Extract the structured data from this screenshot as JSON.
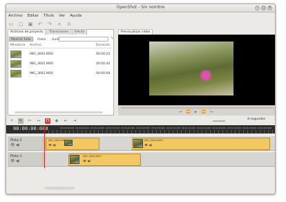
{
  "window": {
    "title": "OpenShot - Sin nombre"
  },
  "menu": [
    "Archivo",
    "Editar",
    "Título",
    "Ver",
    "Ayuda"
  ],
  "left_tabs": [
    "Archivos de proyecto",
    "Transiciones",
    "Efecto"
  ],
  "filters": [
    "Mostrar todo",
    "Video",
    "Audio",
    "Imagen"
  ],
  "columns": {
    "thumb": "Miniatura",
    "file": "Archivo",
    "duration": "Duración"
  },
  "files": [
    {
      "name": "IMG_3003.MOV",
      "duration": "00:00:23"
    },
    {
      "name": "IMG_3002.MOV",
      "duration": "00:00:44"
    },
    {
      "name": "IMG_3003.MOV",
      "duration": "00:00:09"
    }
  ],
  "preview": {
    "tab": "Previsualizar vídeo"
  },
  "zoom": {
    "label": "8 segundos"
  },
  "timeline": {
    "timecode": "00:00:00:000",
    "ruler": [
      "00:00:08:000",
      "00:00:16:000",
      "00:00:24:000",
      "00:00:32:000",
      "00:00:40:000",
      "00:00:48:000",
      "00:00:56:000",
      "00:01:04:000",
      "00:01:12:000",
      "00:01:20:000",
      "00:01:28:000",
      "00:01:36:000",
      "00:01:44:000",
      "00:01:52:000"
    ],
    "tracks": [
      {
        "name": "Pista 2",
        "clips": [
          {
            "name": "IMG_3005.MOV"
          },
          {
            "name": "IMG_3004.MOV"
          }
        ]
      },
      {
        "name": "Pista 1",
        "clips": [
          {
            "name": "IMG_3003.MOV"
          }
        ]
      }
    ]
  }
}
